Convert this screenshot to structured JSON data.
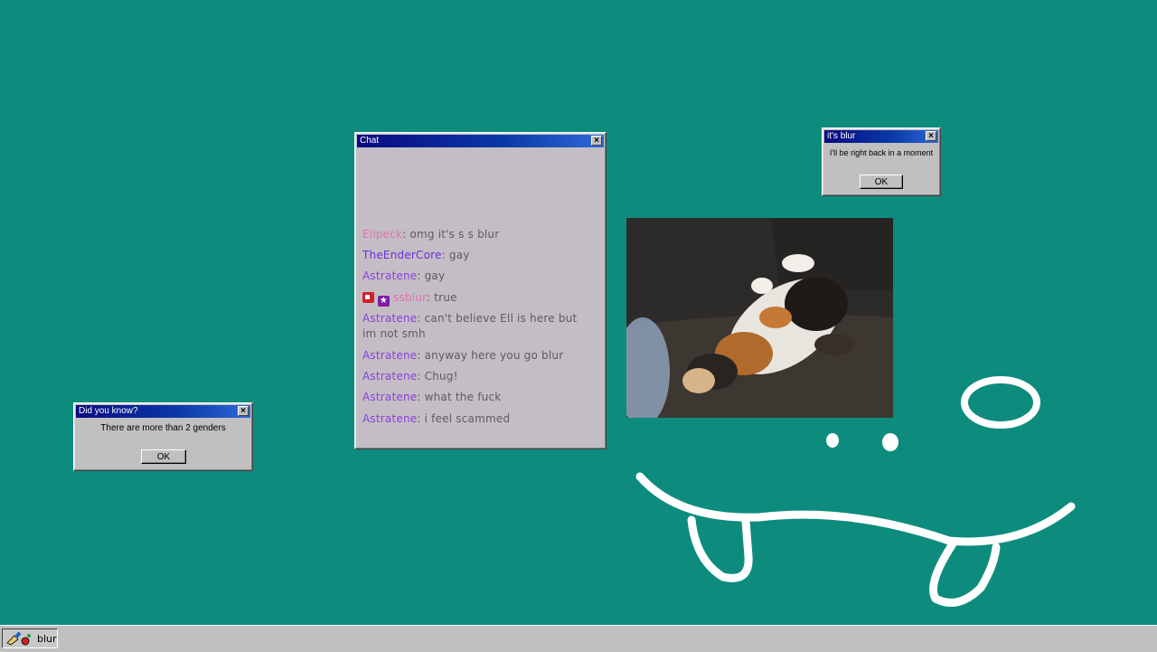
{
  "colors": {
    "desktop": "#0d8c7e",
    "chat_bg": "#c4bdc6",
    "pink_user": "#e26fb0",
    "blue_user": "#6a2fd6",
    "purple_user": "#8a3fd8",
    "message_text": "#5c5c5c"
  },
  "chat_window": {
    "title": "Chat",
    "close_icon": "close-icon",
    "messages": [
      {
        "user": "Ellpeck",
        "text": "omg it's s s blur",
        "color": "#e26fb0",
        "badges": []
      },
      {
        "user": "TheEnderCore",
        "text": "gay",
        "color": "#6a2fd6",
        "badges": []
      },
      {
        "user": "Astratene",
        "text": "gay",
        "color": "#8a3fd8",
        "badges": []
      },
      {
        "user": "ssblur",
        "text": "true",
        "color": "#e26fb0",
        "badges": [
          "broadcaster-icon",
          "star-icon"
        ]
      },
      {
        "user": "Astratene",
        "text": "can't believe Ell is here but im not smh",
        "color": "#8a3fd8",
        "badges": []
      },
      {
        "user": "Astratene",
        "text": "anyway here you go blur",
        "color": "#8a3fd8",
        "badges": []
      },
      {
        "user": "Astratene",
        "text": "Chug!",
        "color": "#8a3fd8",
        "badges": []
      },
      {
        "user": "Astratene",
        "text": "what the fuck",
        "color": "#8a3fd8",
        "badges": []
      },
      {
        "user": "Astratene",
        "text": "i feel scammed",
        "color": "#8a3fd8",
        "badges": []
      }
    ]
  },
  "brb_dialog": {
    "title": "it's blur",
    "message": "I'll be right back in a moment",
    "ok_label": "OK"
  },
  "fact_dialog": {
    "title": "Did you know?",
    "message": "There are more than 2 genders",
    "ok_label": "OK"
  },
  "taskbar": {
    "item_label": "blur",
    "item_icon": "paint-icon"
  }
}
